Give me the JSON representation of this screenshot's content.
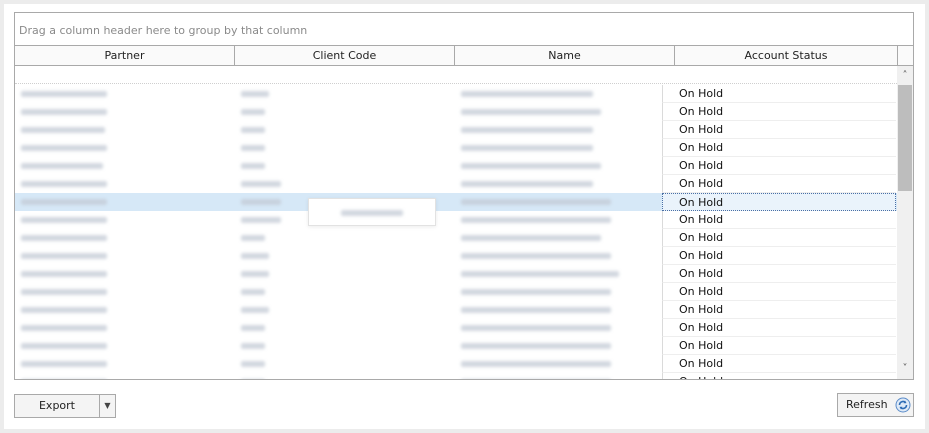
{
  "grid": {
    "group_panel_text": "Drag a column header here to group by that column",
    "columns": [
      {
        "key": "partner",
        "label": "Partner"
      },
      {
        "key": "client_code",
        "label": "Client Code"
      },
      {
        "key": "name",
        "label": "Name"
      },
      {
        "key": "account_status",
        "label": "Account Status"
      }
    ],
    "rows": [
      {
        "account_status": "On Hold",
        "selected": false
      },
      {
        "account_status": "On Hold",
        "selected": false
      },
      {
        "account_status": "On Hold",
        "selected": false
      },
      {
        "account_status": "On Hold",
        "selected": false
      },
      {
        "account_status": "On Hold",
        "selected": false
      },
      {
        "account_status": "On Hold",
        "selected": false
      },
      {
        "account_status": "On Hold",
        "selected": true
      },
      {
        "account_status": "On Hold",
        "selected": false
      },
      {
        "account_status": "On Hold",
        "selected": false
      },
      {
        "account_status": "On Hold",
        "selected": false
      },
      {
        "account_status": "On Hold",
        "selected": false
      },
      {
        "account_status": "On Hold",
        "selected": false
      },
      {
        "account_status": "On Hold",
        "selected": false
      },
      {
        "account_status": "On Hold",
        "selected": false
      },
      {
        "account_status": "On Hold",
        "selected": false
      },
      {
        "account_status": "On Hold",
        "selected": false
      },
      {
        "account_status": "On Hold",
        "selected": false
      }
    ],
    "scroll_up_icon": "chevron-up-icon",
    "scroll_down_icon": "chevron-down-icon"
  },
  "footer": {
    "export_label": "Export",
    "export_dropdown_icon": "caret-down-icon",
    "refresh_label": "Refresh",
    "refresh_icon": "refresh-icon"
  },
  "colors": {
    "selected_row": "#d6e8f7",
    "border": "#a9a9a9",
    "scroll_thumb": "#bdbdbd"
  }
}
